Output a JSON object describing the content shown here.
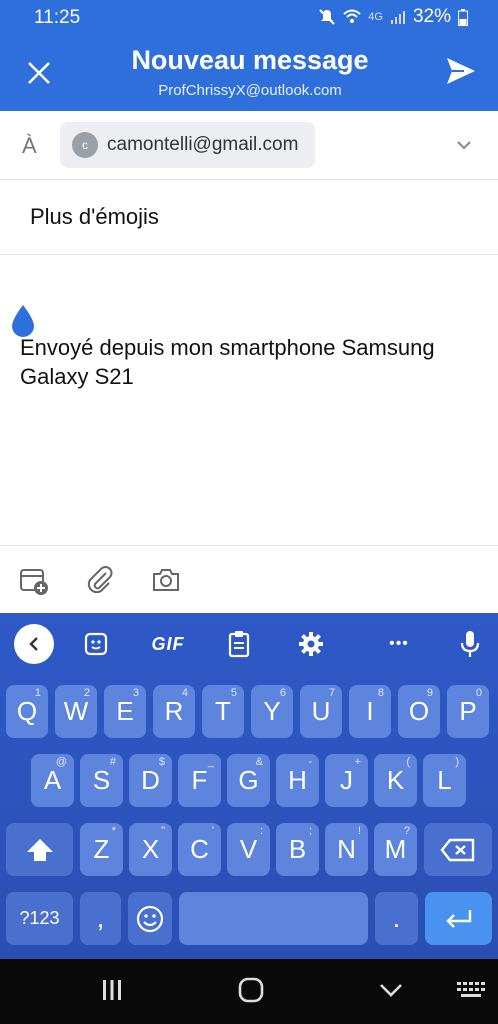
{
  "status": {
    "time": "11:25",
    "network": "4G",
    "battery": "32%"
  },
  "header": {
    "title": "Nouveau message",
    "account": "ProfChrissyX@outlook.com"
  },
  "recipient": {
    "label": "À",
    "avatar_initial": "c",
    "email": "camontelli@gmail.com"
  },
  "subject": "Plus d'émojis",
  "body": {
    "signature": "Envoyé depuis mon smartphone Samsung Galaxy S21"
  },
  "toolbar": {
    "icons": [
      "calendar-add-icon",
      "attachment-icon",
      "camera-icon"
    ]
  },
  "keyboard": {
    "toolbar": {
      "gif_label": "GIF",
      "more_label": "•••"
    },
    "row1": [
      {
        "k": "Q",
        "h": "1"
      },
      {
        "k": "W",
        "h": "2"
      },
      {
        "k": "E",
        "h": "3"
      },
      {
        "k": "R",
        "h": "4"
      },
      {
        "k": "T",
        "h": "5"
      },
      {
        "k": "Y",
        "h": "6"
      },
      {
        "k": "U",
        "h": "7"
      },
      {
        "k": "I",
        "h": "8"
      },
      {
        "k": "O",
        "h": "9"
      },
      {
        "k": "P",
        "h": "0"
      }
    ],
    "row2": [
      {
        "k": "A",
        "h": "@"
      },
      {
        "k": "S",
        "h": "#"
      },
      {
        "k": "D",
        "h": "$"
      },
      {
        "k": "F",
        "h": "_"
      },
      {
        "k": "G",
        "h": "&"
      },
      {
        "k": "H",
        "h": "-"
      },
      {
        "k": "J",
        "h": "+"
      },
      {
        "k": "K",
        "h": "("
      },
      {
        "k": "L",
        "h": ")"
      }
    ],
    "row3": [
      {
        "k": "Z",
        "h": "*"
      },
      {
        "k": "X",
        "h": "\""
      },
      {
        "k": "C",
        "h": "'"
      },
      {
        "k": "V",
        "h": ":"
      },
      {
        "k": "B",
        "h": ";"
      },
      {
        "k": "N",
        "h": "!"
      },
      {
        "k": "M",
        "h": "?"
      }
    ],
    "symbols_label": "?123",
    "comma_label": ",",
    "period_label": "."
  },
  "colors": {
    "brand": "#2f6fdb",
    "keyboard": "#2f59c7",
    "key": "#5d85dd"
  }
}
